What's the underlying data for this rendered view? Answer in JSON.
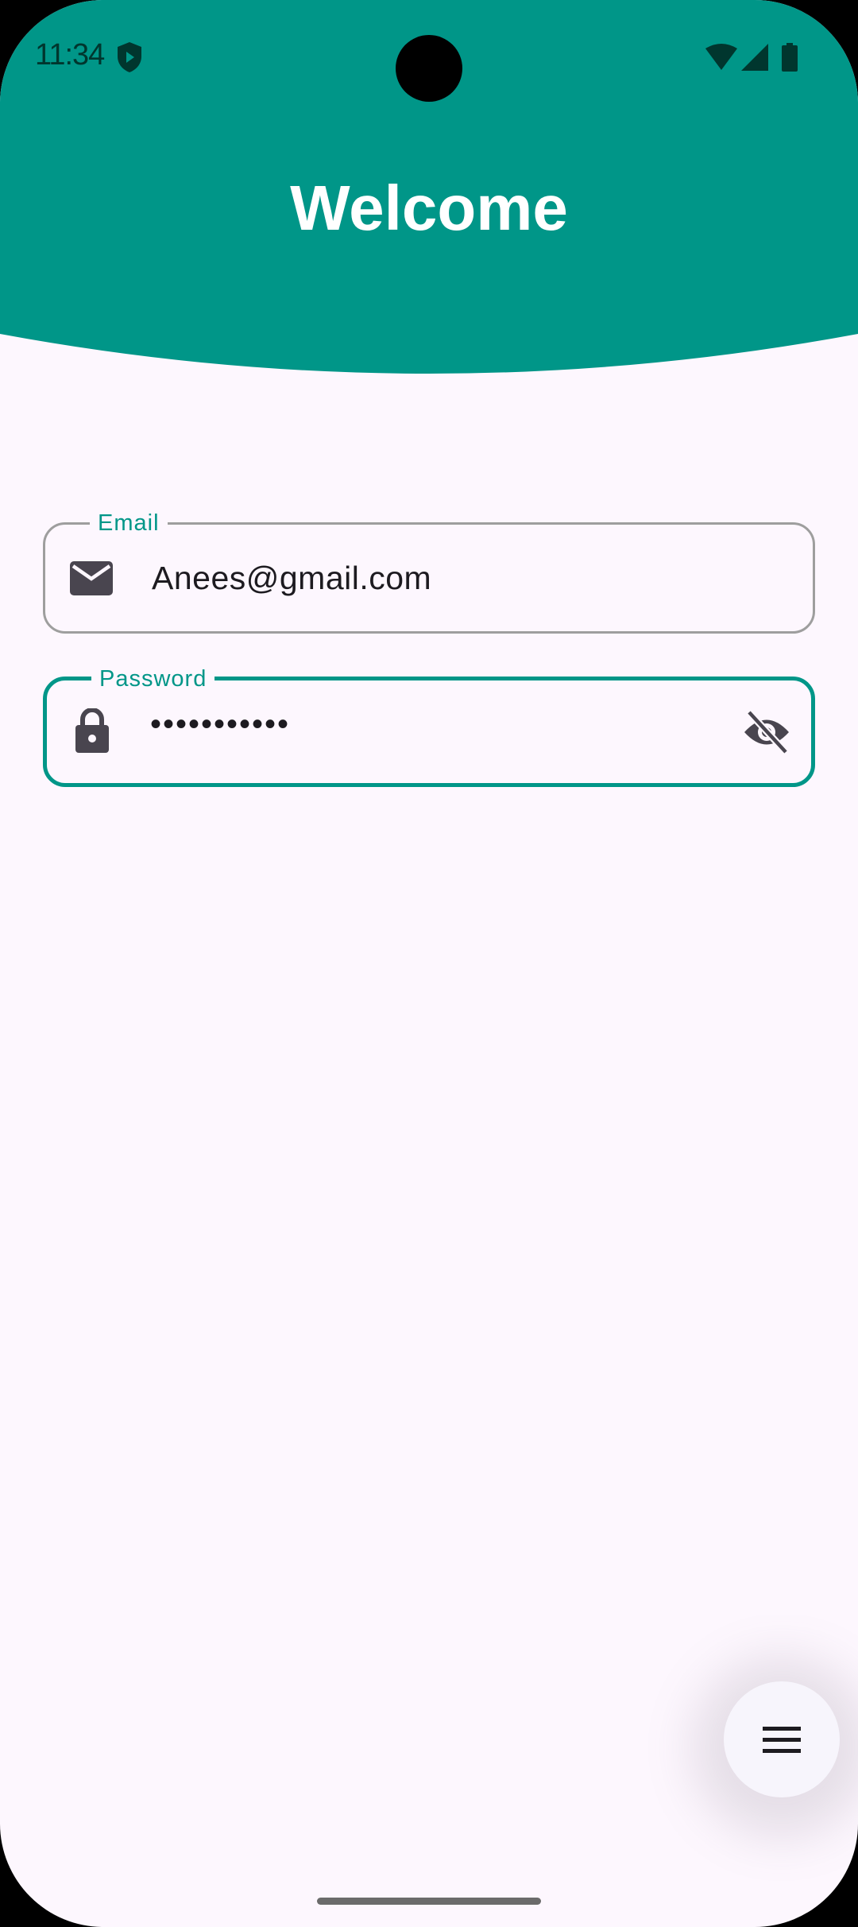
{
  "status_bar": {
    "time": "11:34",
    "icons": [
      "shield-play-icon",
      "wifi-icon",
      "signal-icon",
      "battery-icon"
    ]
  },
  "header": {
    "title": "Welcome",
    "color": "#009688"
  },
  "form": {
    "email": {
      "label": "Email",
      "value": "Anees@gmail.com",
      "icon": "mail-icon"
    },
    "password": {
      "label": "Password",
      "value": "•••••••••••",
      "icon": "lock-icon",
      "toggle_icon": "visibility-off-icon"
    }
  },
  "fab": {
    "icon": "menu-icon"
  },
  "colors": {
    "accent": "#009688",
    "background": "#fdf7fe",
    "outline": "#9e9e9e"
  }
}
